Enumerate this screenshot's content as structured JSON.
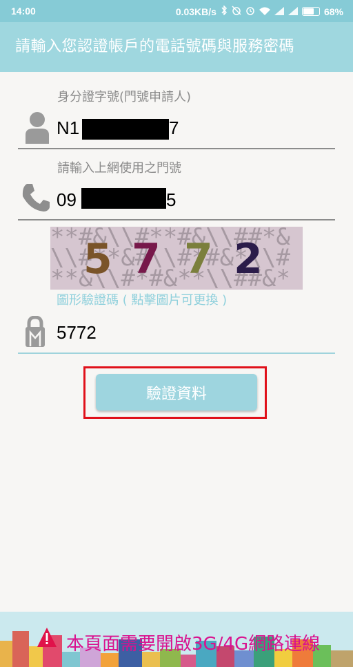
{
  "status_bar": {
    "time": "14:00",
    "network_speed": "0.03KB/s",
    "battery": "68%",
    "icons": [
      "bluetooth-icon",
      "alarm-off-icon",
      "alarm-icon",
      "wifi-icon",
      "signal-icon",
      "signal-icon",
      "battery-icon"
    ]
  },
  "header": {
    "title": "請輸入您認證帳戶的電話號碼與服務密碼"
  },
  "id_field": {
    "label": "身分證字號(門號申請人)",
    "value_prefix": "N1",
    "value_suffix": "7",
    "icon": "person-icon"
  },
  "phone_field": {
    "label": "請輸入上網使用之門號",
    "value_prefix": "09",
    "value_suffix": "5",
    "icon": "phone-icon"
  },
  "captcha": {
    "digits": [
      "5",
      "7",
      "7",
      "2"
    ],
    "digit_colors": [
      "#7a5429",
      "#77184a",
      "#7b7f3c",
      "#2b1c4a"
    ],
    "hint": "圖形驗證碼 ( 點擊圖片可更換 )"
  },
  "captcha_field": {
    "value": "5772",
    "icon": "lock-icon"
  },
  "verify_button": {
    "label": "驗證資料"
  },
  "footer": {
    "message": "本頁面需要開啟3G/4G網路連線",
    "icon": "warning-icon"
  },
  "colors": {
    "accent": "#9fd7df",
    "highlight": "#e0101a",
    "footer_text": "#d9128f"
  }
}
